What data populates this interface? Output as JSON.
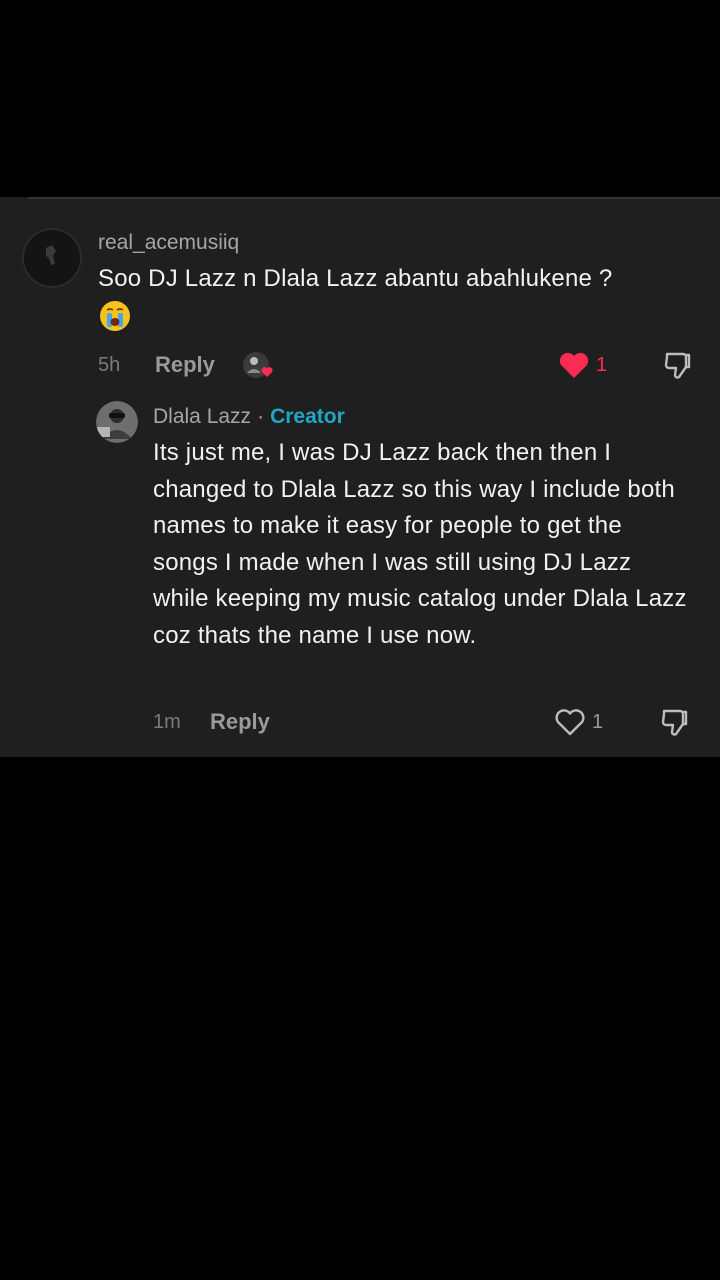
{
  "comment": {
    "username": "real_acemusiiq",
    "text": "Soo DJ Lazz n Dlala Lazz abantu abahlukene ?",
    "emoji": "😭",
    "time": "5h",
    "reply_label": "Reply",
    "like_count": "1",
    "liked": true,
    "like_color": "#fe2c55"
  },
  "reply": {
    "username": "Dlala Lazz",
    "separator": "·",
    "badge": "Creator",
    "badge_color": "#1fa7c4",
    "text": "Its just me, I was DJ Lazz back then then I changed to Dlala Lazz so this way I include both names to make it easy for people to get the songs I made when I was still using DJ Lazz while keeping my music catalog under Dlala Lazz coz thats the name I use now.",
    "time": "1m",
    "reply_label": "Reply",
    "like_count": "1",
    "liked": false
  },
  "icons": {
    "like": "heart-icon",
    "dislike": "thumbs-down-icon",
    "creator_liked": "creator-liked-badge-icon"
  }
}
